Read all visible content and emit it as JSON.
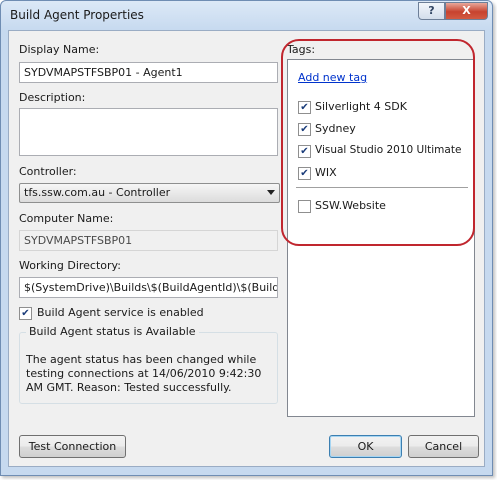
{
  "window": {
    "title": "Build Agent Properties",
    "help_glyph": "?",
    "close_glyph": "X"
  },
  "left": {
    "display_name_label": "Display Name:",
    "display_name_value": "SYDVMAPSTFSBP01 - Agent1",
    "description_label": "Description:",
    "description_value": "",
    "controller_label": "Controller:",
    "controller_value": "tfs.ssw.com.au - Controller",
    "computer_name_label": "Computer Name:",
    "computer_name_value": "SYDVMAPSTFSBP01",
    "working_dir_label": "Working Directory:",
    "working_dir_value": "$(SystemDrive)\\Builds\\$(BuildAgentId)\\$(BuildDef",
    "service_enabled_label": "Build Agent service is enabled",
    "service_enabled_checked": true,
    "status_group_title": "Build Agent status is Available",
    "status_message": "The agent status has been changed while testing connections at 14/06/2010 9:42:30 AM GMT. Reason: Tested successfully."
  },
  "tags": {
    "label": "Tags:",
    "add_new_label": "Add new tag",
    "selected": [
      {
        "label": "Silverlight 4 SDK",
        "checked": true
      },
      {
        "label": "Sydney",
        "checked": true
      },
      {
        "label": "Visual Studio 2010 Ultimate",
        "checked": true
      },
      {
        "label": "WIX",
        "checked": true
      }
    ],
    "available": [
      {
        "label": "SSW.Website",
        "checked": false
      }
    ],
    "highlight_color": "#c0262e"
  },
  "buttons": {
    "test_connection": "Test Connection",
    "ok": "OK",
    "cancel": "Cancel"
  },
  "check_glyph": "✔"
}
